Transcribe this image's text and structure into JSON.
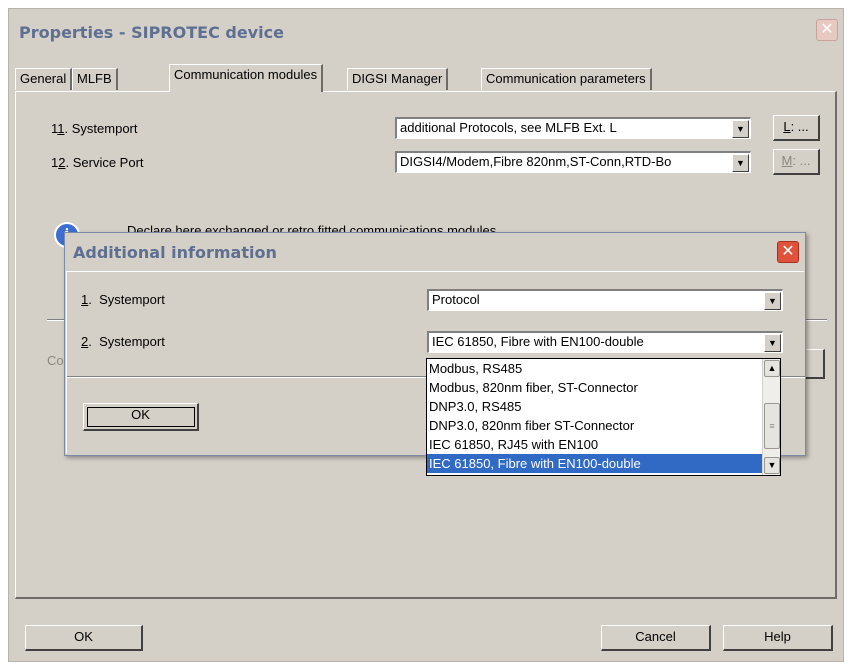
{
  "window": {
    "title": "Properties - SIPROTEC device",
    "close_glyph": "✕"
  },
  "tabs": [
    {
      "label": "General",
      "selected": false
    },
    {
      "label": "MLFB",
      "selected": false
    },
    {
      "label": "Communication modules",
      "selected": true
    },
    {
      "label": "DIGSI Manager",
      "selected": false
    },
    {
      "label": "Communication parameters",
      "selected": false
    }
  ],
  "ports": [
    {
      "num_pre": "1",
      "num_u": "1",
      "dot": ".",
      "label": "Systemport",
      "value": "additional Protocols, see MLFB Ext. L",
      "button_u": "L",
      "button_rest": ": ...",
      "button_enabled": true
    },
    {
      "num_pre": "1",
      "num_u": "2",
      "dot": ".",
      "label": "Service Port",
      "value": "DIGSI4/Modem,Fibre 820nm,ST-Conn,RTD-Bo",
      "button_u": "M",
      "button_rest": ": ...",
      "button_enabled": false
    }
  ],
  "info": {
    "icon": "info-icon",
    "text": "Declare here exchanged or retro fitted communications modules"
  },
  "bottom": {
    "ok": "OK",
    "cancel": "Cancel",
    "help": "Help",
    "partial_label": "Co"
  },
  "dialog": {
    "title": "Additional information",
    "close_glyph": "✕",
    "rows": [
      {
        "num": "1",
        "dot": ".",
        "label": "Systemport",
        "value": "Protocol"
      },
      {
        "num": "2",
        "dot": ".",
        "label": "Systemport",
        "value": "IEC 61850, Fibre with EN100-double"
      }
    ],
    "ok": "OK",
    "dropdown_options": [
      {
        "label": "Modbus, RS485",
        "selected": false
      },
      {
        "label": "Modbus, 820nm fiber, ST-Connector",
        "selected": false
      },
      {
        "label": "DNP3.0, RS485",
        "selected": false
      },
      {
        "label": "DNP3.0, 820nm fiber ST-Connector",
        "selected": false
      },
      {
        "label": "IEC 61850, RJ45 with EN100",
        "selected": false
      },
      {
        "label": "IEC 61850, Fibre with EN100-double",
        "selected": true
      }
    ]
  },
  "colors": {
    "title_text": "#5e6f92",
    "selection": "#316ac5",
    "close_active": "#e0533a"
  }
}
